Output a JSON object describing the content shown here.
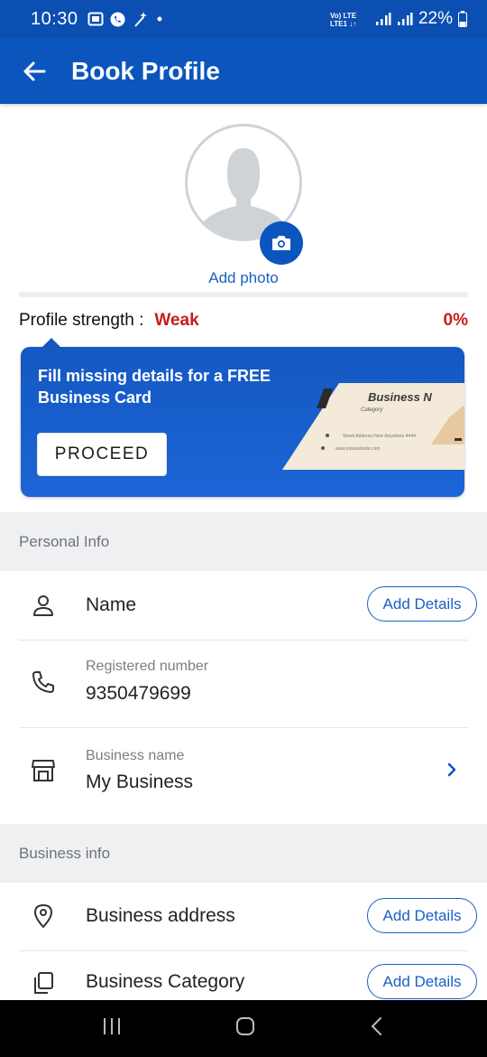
{
  "status_bar": {
    "time": "10:30",
    "left_icons": [
      "screenshot-icon",
      "whatsapp-icon",
      "magic-wand-icon",
      "dot-icon"
    ],
    "network_label": "Vo) LTE LTE1",
    "battery": "22%"
  },
  "app_bar": {
    "title": "Book Profile",
    "back_icon": "arrow-left-icon"
  },
  "profile": {
    "add_photo_label": "Add photo",
    "strength_label": "Profile strength :",
    "strength_value": "Weak",
    "strength_percent": "0%",
    "strength_progress": 0
  },
  "promo": {
    "text": "Fill missing details for a FREE Business Card",
    "button_label": "PROCEED",
    "card_title": "Business N",
    "card_category": "Category",
    "card_address": "Street Address Here Anywhere 4444",
    "card_website": "www.yourwebsite.com"
  },
  "personal_info": {
    "header": "Personal Info",
    "name_label": "Name",
    "name_button": "Add Details",
    "phone_label": "Registered number",
    "phone_value": "9350479699",
    "business_label": "Business name",
    "business_value": "My Business"
  },
  "business_info": {
    "header": "Business info",
    "address_label": "Business address",
    "address_button": "Add Details",
    "category_label": "Business Category",
    "category_button": "Add Details"
  },
  "colors": {
    "primary": "#0b55bd",
    "link": "#1a5fc4",
    "weak": "#c91c1c"
  }
}
